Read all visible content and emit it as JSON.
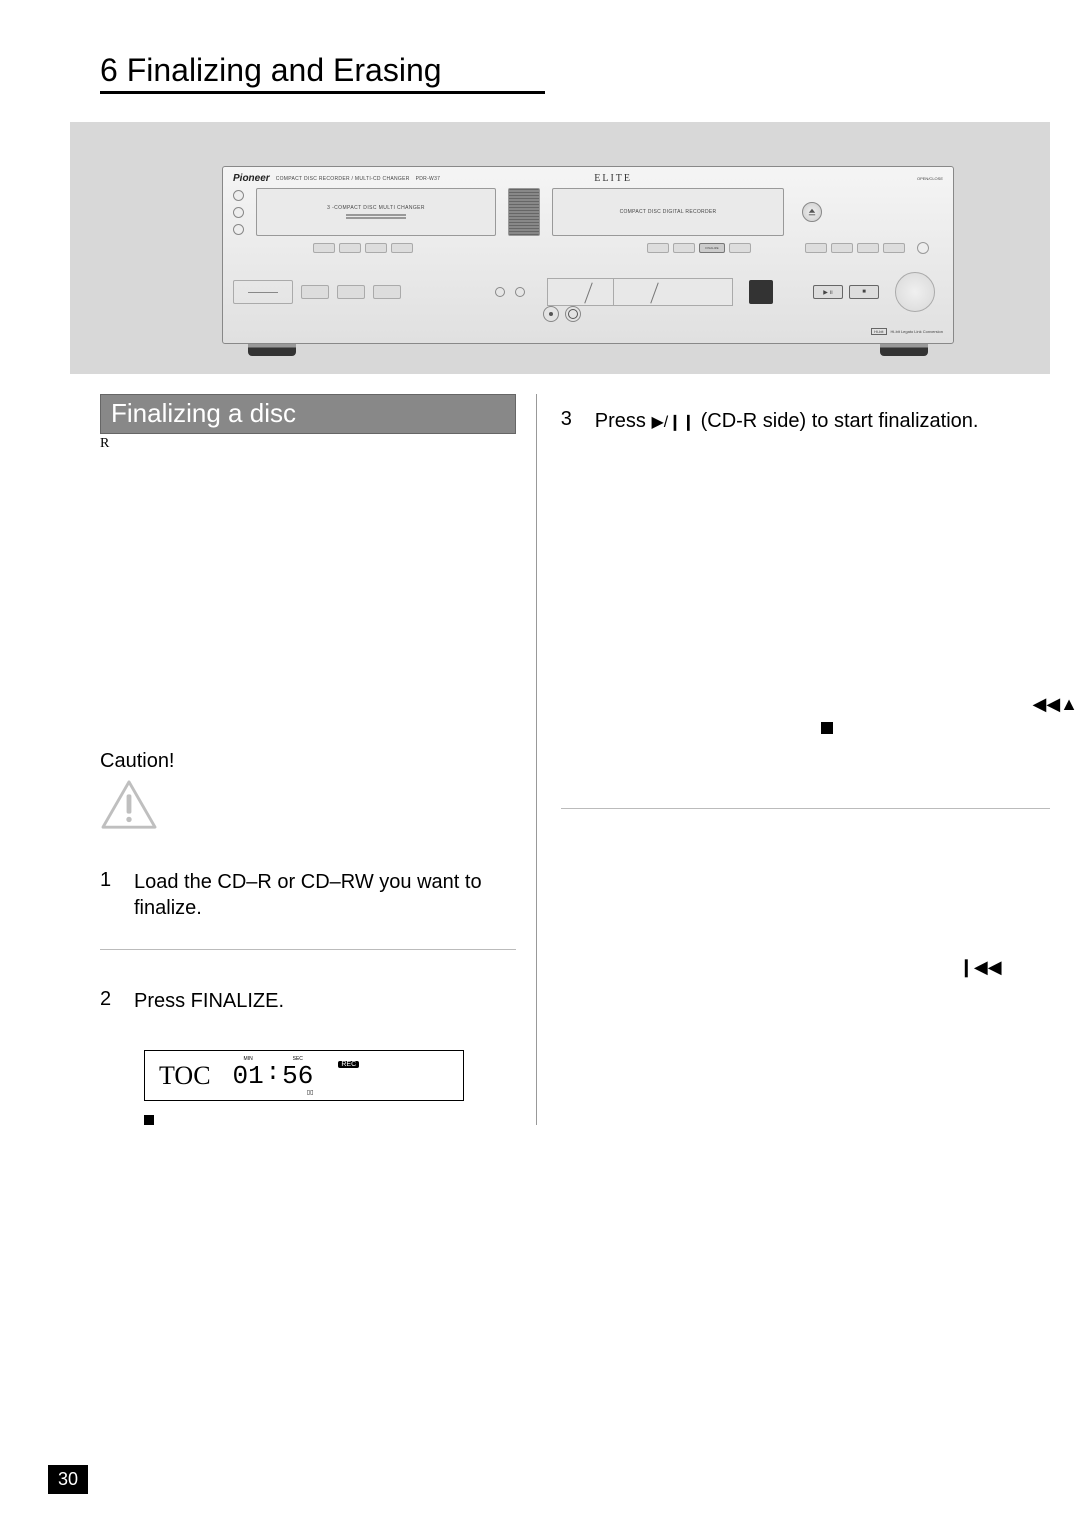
{
  "page": {
    "chapter_num": "6",
    "chapter_title": "Finalizing and Erasing",
    "page_number": "30"
  },
  "device": {
    "brand": "Pioneer",
    "model_desc": "COMPACT DISC RECORDER / MULTI-CD CHANGER",
    "model": "PDR-W37",
    "elite": "ELITE",
    "open_close": "OPEN/CLOSE",
    "tray_left_label": "3 -COMPACT DISC MULTI CHANGER",
    "tray_right_label": "COMPACT DISC DIGITAL RECORDER",
    "finalize": "FINALIZE",
    "hibit": "Hi-bit",
    "legato": "Hi-bit Legato Link Conversion"
  },
  "section": {
    "title": "Finalizing a disc",
    "sub": "R",
    "caution": "Caution!"
  },
  "steps": {
    "s1": "Load the CD–R or CD–RW you want to finalize.",
    "s2": "Press FINALIZE.",
    "s3_prefix": "Press ",
    "s3_suffix": " (CD-R side) to start final­ization."
  },
  "display": {
    "toc": "TOC",
    "min_label": "MIN",
    "sec_label": "SEC",
    "min": "01",
    "colon": ":",
    "sec": "56",
    "rec": "REC"
  }
}
